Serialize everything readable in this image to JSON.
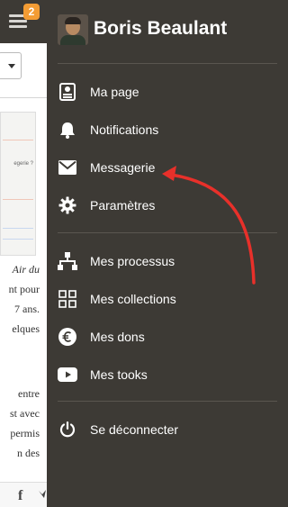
{
  "topbar": {
    "notification_count": "2"
  },
  "background": {
    "thumb_text": "egerie ?",
    "text_block_1": [
      "Air du",
      "nt pour",
      "7 ans.",
      "elques"
    ],
    "text_block_2": [
      "entre",
      "st avec",
      "permis",
      "n des"
    ],
    "footer": {
      "facebook": "f",
      "twitter": "🐦"
    }
  },
  "drawer": {
    "user_name": "Boris Beaulant",
    "items_top": [
      {
        "label": "Ma page",
        "icon": "profile-icon"
      },
      {
        "label": "Notifications",
        "icon": "bell-icon"
      },
      {
        "label": "Messagerie",
        "icon": "envelope-icon"
      },
      {
        "label": "Paramètres",
        "icon": "gear-icon"
      }
    ],
    "items_middle": [
      {
        "label": "Mes processus",
        "icon": "sitemap-icon"
      },
      {
        "label": "Mes collections",
        "icon": "grid-icon"
      },
      {
        "label": "Mes dons",
        "icon": "euro-icon"
      },
      {
        "label": "Mes tooks",
        "icon": "play-icon"
      }
    ],
    "items_bottom": [
      {
        "label": "Se déconnecter",
        "icon": "power-icon"
      }
    ]
  },
  "annotation": {
    "arrow_color": "#e8302a"
  },
  "colors": {
    "drawer_bg": "#3d3a35",
    "badge": "#f39c34",
    "text": "#ffffff"
  }
}
